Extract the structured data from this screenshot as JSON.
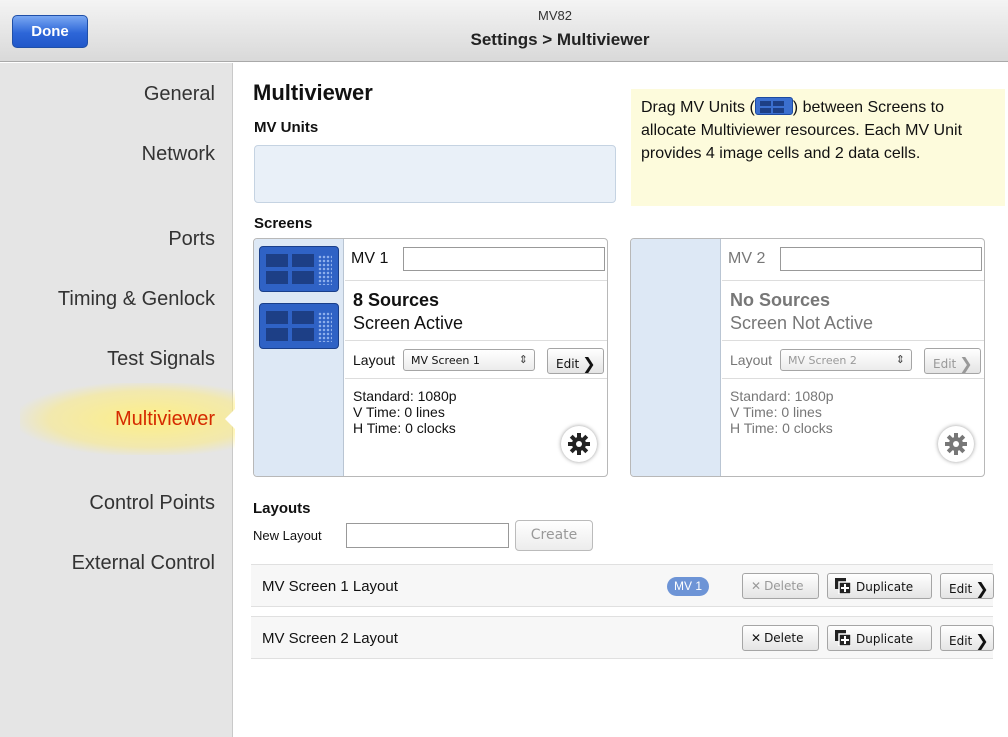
{
  "header": {
    "done_label": "Done",
    "device_name": "MV82",
    "path": "Settings > Multiviewer"
  },
  "sidebar": {
    "items": [
      {
        "label": "General"
      },
      {
        "label": "Network"
      },
      {
        "label": "Ports"
      },
      {
        "label": "Timing & Genlock"
      },
      {
        "label": "Test Signals"
      },
      {
        "label": "Multiviewer",
        "active": true
      },
      {
        "label": "Control Points"
      },
      {
        "label": "External Control"
      }
    ]
  },
  "main": {
    "title": "Multiviewer",
    "mv_units_heading": "MV Units",
    "hint": {
      "before_chip": "Drag MV Units (",
      "after_chip": ") between Screens to allocate Multiviewer resources. Each MV Unit provides 4 image cells and 2 data cells."
    },
    "screens_heading": "Screens",
    "screens": [
      {
        "name": "MV 1",
        "name_value": "",
        "sources": "8 Sources",
        "status": "Screen Active",
        "layout_label": "Layout",
        "layout_value": "MV Screen 1",
        "edit_label": "Edit",
        "standard": "Standard: 1080p",
        "v_time": "V Time: 0 lines",
        "h_time": "H Time: 0 clocks",
        "active": true,
        "unit_count": 2
      },
      {
        "name": "MV 2",
        "name_value": "",
        "sources": "No Sources",
        "status": "Screen Not Active",
        "layout_label": "Layout",
        "layout_value": "MV Screen 2",
        "edit_label": "Edit",
        "standard": "Standard: 1080p",
        "v_time": "V Time: 0 lines",
        "h_time": "H Time: 0 clocks",
        "active": false,
        "unit_count": 0
      }
    ],
    "layouts_heading": "Layouts",
    "new_layout_label": "New Layout",
    "new_layout_value": "",
    "create_label": "Create",
    "layouts": [
      {
        "name": "MV Screen 1 Layout",
        "badge": "MV 1",
        "delete_label": "Delete",
        "delete_enabled": false,
        "duplicate_label": "Duplicate",
        "edit_label": "Edit"
      },
      {
        "name": "MV Screen 2 Layout",
        "badge": "",
        "delete_label": "Delete",
        "delete_enabled": true,
        "duplicate_label": "Duplicate",
        "edit_label": "Edit"
      }
    ]
  },
  "colors": {
    "accent_blue": "#2d66d8",
    "active_red": "#d52a00",
    "hint_bg": "#fdfbdc"
  },
  "icons": [
    "gear-icon",
    "chevron-right-icon",
    "close-icon",
    "duplicate-icon",
    "mv-unit-icon"
  ]
}
